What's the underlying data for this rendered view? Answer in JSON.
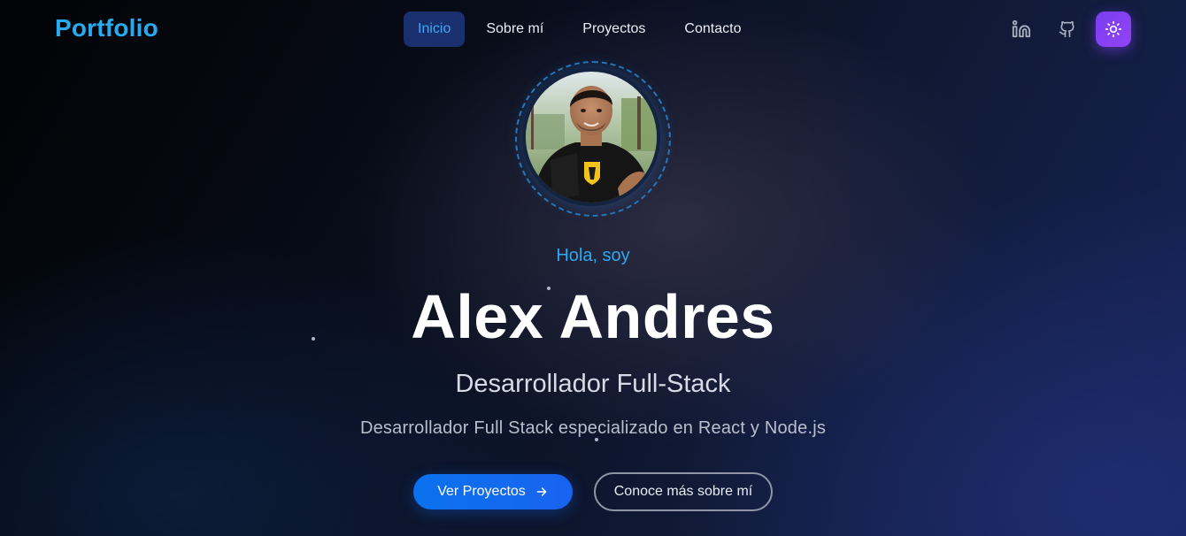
{
  "navbar": {
    "logo": "Portfolio",
    "links": [
      {
        "label": "Inicio",
        "active": true
      },
      {
        "label": "Sobre mí",
        "active": false
      },
      {
        "label": "Proyectos",
        "active": false
      },
      {
        "label": "Contacto",
        "active": false
      }
    ],
    "actions": [
      {
        "icon": "linkedin-icon"
      },
      {
        "icon": "github-icon"
      },
      {
        "icon": "sun-icon"
      }
    ]
  },
  "hero": {
    "avatar_alt": "profile-photo",
    "greeting": "Hola, soy",
    "name": "Alex Andres",
    "role": "Desarrollador Full-Stack",
    "tagline": "Desarrollador Full Stack especializado en React y Node.js",
    "primary_cta": "Ver Proyectos",
    "secondary_cta": "Conoce más sobre mí"
  },
  "colors": {
    "accent": "#29a9ee",
    "primary_button": "#0a72ee",
    "theme_toggle": "#8b42f3",
    "active_nav_bg": "#1a2f6e"
  }
}
